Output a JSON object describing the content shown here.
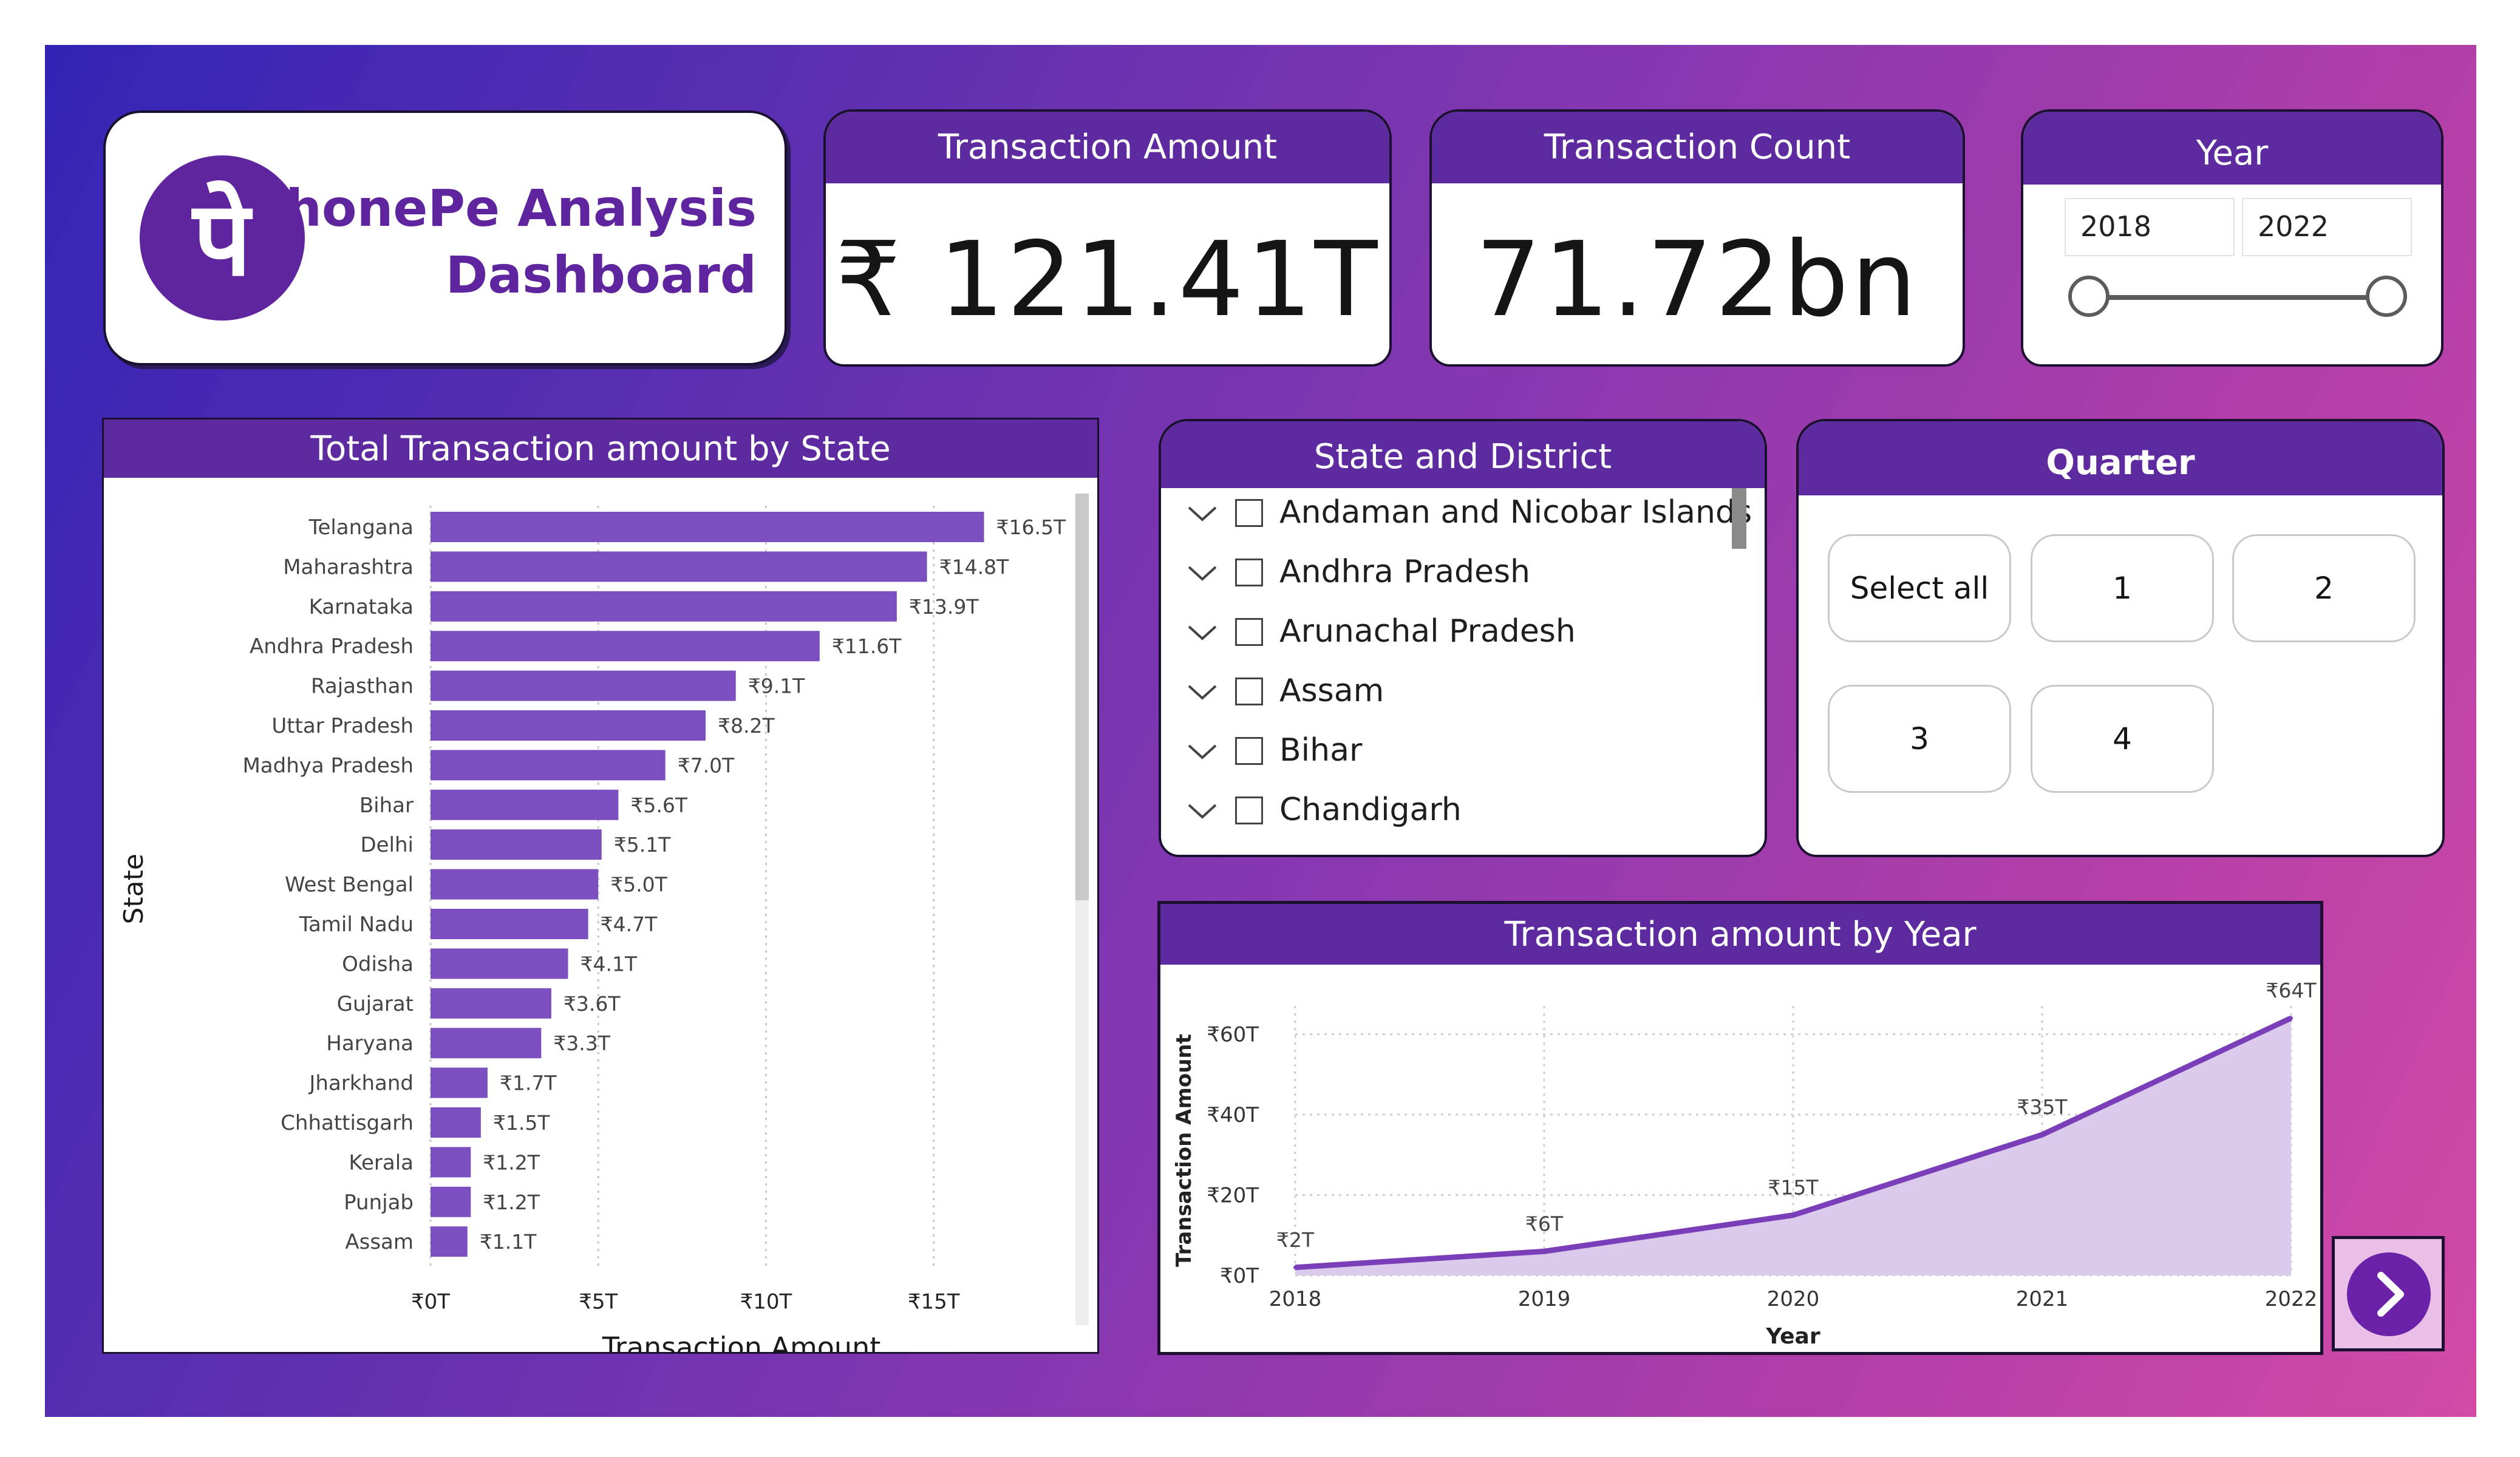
{
  "brand": {
    "line1": "PhonePe Analysis",
    "line2": "Dashboard",
    "logo_glyph": "पे",
    "logo_color": "#5f259f"
  },
  "kpis": [
    {
      "title": "Transaction Amount",
      "value": "₹ 121.41T"
    },
    {
      "title": "Transaction Count",
      "value": "71.72bn"
    }
  ],
  "year_slicer": {
    "title": "Year",
    "from": "2018",
    "to": "2022"
  },
  "state_district": {
    "title": "State and District",
    "items": [
      "Andaman and Nicobar Islands",
      "Andhra Pradesh",
      "Arunachal Pradesh",
      "Assam",
      "Bihar",
      "Chandigarh"
    ]
  },
  "quarter": {
    "title": "Quarter",
    "options": [
      "Select all",
      "1",
      "2",
      "3",
      "4"
    ]
  },
  "colors": {
    "header": "#5d2aa0",
    "bar": "#7b4fbf",
    "line": "#7a3fb8",
    "area": "#d9c7ea"
  },
  "chart_data": [
    {
      "type": "bar",
      "orientation": "horizontal",
      "title": "Total Transaction amount by State",
      "xlabel": "Transaction Amount",
      "ylabel": "State",
      "categories": [
        "Telangana",
        "Maharashtra",
        "Karnataka",
        "Andhra Pradesh",
        "Rajasthan",
        "Uttar Pradesh",
        "Madhya Pradesh",
        "Bihar",
        "Delhi",
        "West Bengal",
        "Tamil Nadu",
        "Odisha",
        "Gujarat",
        "Haryana",
        "Jharkhand",
        "Chhattisgarh",
        "Kerala",
        "Punjab",
        "Assam"
      ],
      "values": [
        16.5,
        14.8,
        13.9,
        11.6,
        9.1,
        8.2,
        7.0,
        5.6,
        5.1,
        5.0,
        4.7,
        4.1,
        3.6,
        3.3,
        1.7,
        1.5,
        1.2,
        1.2,
        1.1
      ],
      "data_labels": [
        "₹16.5T",
        "₹14.8T",
        "₹13.9T",
        "₹11.6T",
        "₹9.1T",
        "₹8.2T",
        "₹7.0T",
        "₹5.6T",
        "₹5.1T",
        "₹5.0T",
        "₹4.7T",
        "₹4.1T",
        "₹3.6T",
        "₹3.3T",
        "₹1.7T",
        "₹1.5T",
        "₹1.2T",
        "₹1.2T",
        "₹1.1T"
      ],
      "x_ticks": [
        "₹0T",
        "₹5T",
        "₹10T",
        "₹15T"
      ],
      "x_tick_values": [
        0,
        5,
        10,
        15
      ],
      "xlim": [
        0,
        18.5
      ],
      "grid": true
    },
    {
      "type": "area",
      "title": "Transaction amount by Year",
      "xlabel": "Year",
      "ylabel": "Transaction Amount",
      "x": [
        "2018",
        "2019",
        "2020",
        "2021",
        "2022"
      ],
      "values": [
        2,
        6,
        15,
        35,
        64
      ],
      "data_labels": [
        "₹2T",
        "₹6T",
        "₹15T",
        "₹35T",
        "₹64T"
      ],
      "y_ticks": [
        "₹0T",
        "₹20T",
        "₹40T",
        "₹60T"
      ],
      "y_tick_values": [
        0,
        20,
        40,
        60
      ],
      "ylim": [
        0,
        64
      ],
      "grid": true
    }
  ]
}
